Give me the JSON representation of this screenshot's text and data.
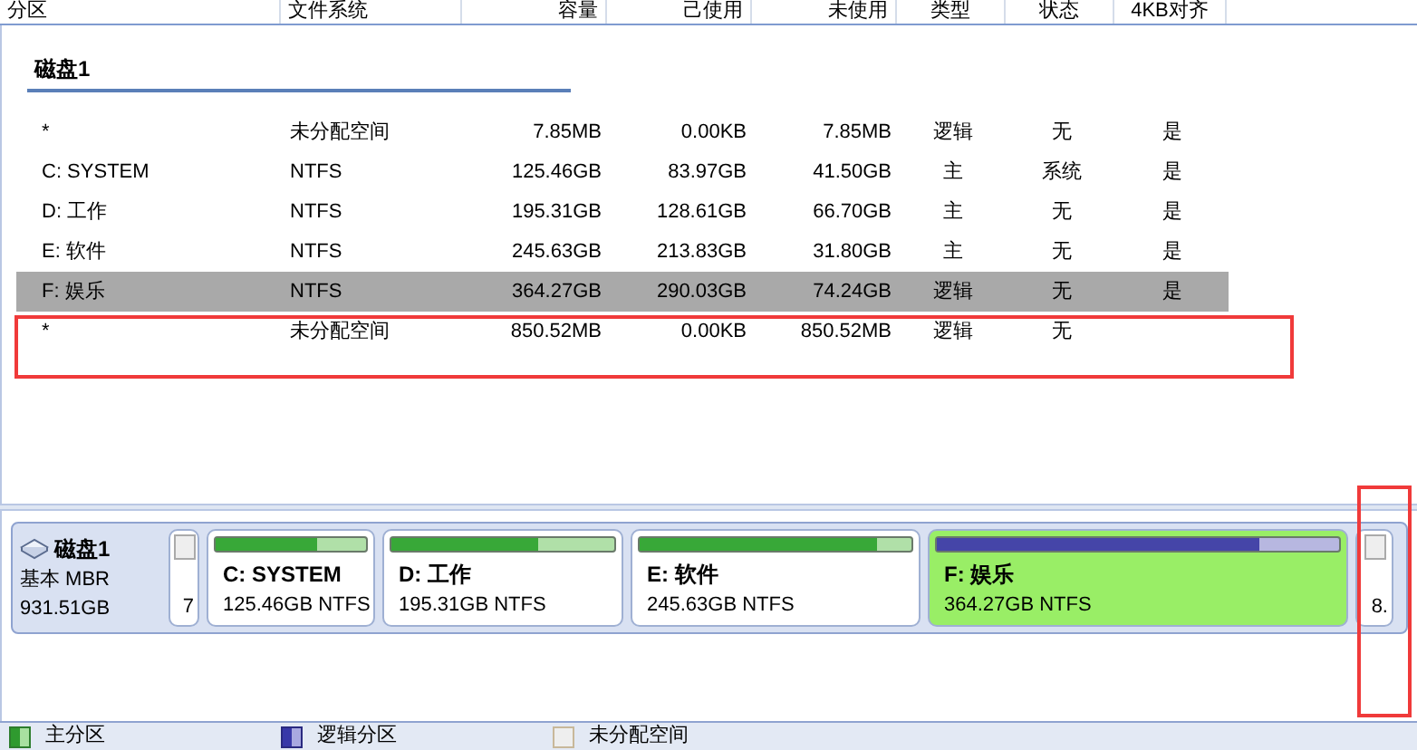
{
  "columns": [
    "分区",
    "文件系统",
    "容量",
    "己使用",
    "未使用",
    "类型",
    "状态",
    "4KB对齐"
  ],
  "disk_group": {
    "name": "磁盘1",
    "rows": [
      {
        "partition": "*",
        "filesystem": "未分配空间",
        "capacity": "7.85MB",
        "used": "0.00KB",
        "unused": "7.85MB",
        "type": "逻辑",
        "status": "无",
        "align": "是",
        "selected": false
      },
      {
        "partition": "C: SYSTEM",
        "filesystem": "NTFS",
        "capacity": "125.46GB",
        "used": "83.97GB",
        "unused": "41.50GB",
        "type": "主",
        "status": "系统",
        "align": "是",
        "selected": false
      },
      {
        "partition": "D: 工作",
        "filesystem": "NTFS",
        "capacity": "195.31GB",
        "used": "128.61GB",
        "unused": "66.70GB",
        "type": "主",
        "status": "无",
        "align": "是",
        "selected": false
      },
      {
        "partition": "E: 软件",
        "filesystem": "NTFS",
        "capacity": "245.63GB",
        "used": "213.83GB",
        "unused": "31.80GB",
        "type": "主",
        "status": "无",
        "align": "是",
        "selected": false
      },
      {
        "partition": "F: 娱乐",
        "filesystem": "NTFS",
        "capacity": "364.27GB",
        "used": "290.03GB",
        "unused": "74.24GB",
        "type": "逻辑",
        "status": "无",
        "align": "是",
        "selected": true
      },
      {
        "partition": "*",
        "filesystem": "未分配空间",
        "capacity": "850.52MB",
        "used": "0.00KB",
        "unused": "850.52MB",
        "type": "逻辑",
        "status": "无",
        "selected": false
      }
    ]
  },
  "disk_map": {
    "name": "磁盘1",
    "scheme": "基本 MBR",
    "size": "931.51GB",
    "partitions": [
      {
        "kind": "unallocated",
        "label": "7",
        "selected": false
      },
      {
        "kind": "primary",
        "name": "C: SYSTEM",
        "detail": "125.46GB NTFS",
        "level": 0.67,
        "selected": false
      },
      {
        "kind": "primary",
        "name": "D: 工作",
        "detail": "195.31GB NTFS",
        "level": 0.66,
        "selected": false
      },
      {
        "kind": "primary",
        "name": "E: 软件",
        "detail": "245.63GB NTFS",
        "level": 0.87,
        "selected": false
      },
      {
        "kind": "logical",
        "name": "F: 娱乐",
        "detail": "364.27GB NTFS",
        "level": 0.8,
        "selected": true
      },
      {
        "kind": "unallocated",
        "label": "8.",
        "selected": false
      }
    ]
  },
  "legend": [
    {
      "kind": "primary",
      "label": "主分区"
    },
    {
      "kind": "logical",
      "label": "逻辑分区"
    },
    {
      "kind": "unallocated",
      "label": "未分配空间"
    }
  ]
}
